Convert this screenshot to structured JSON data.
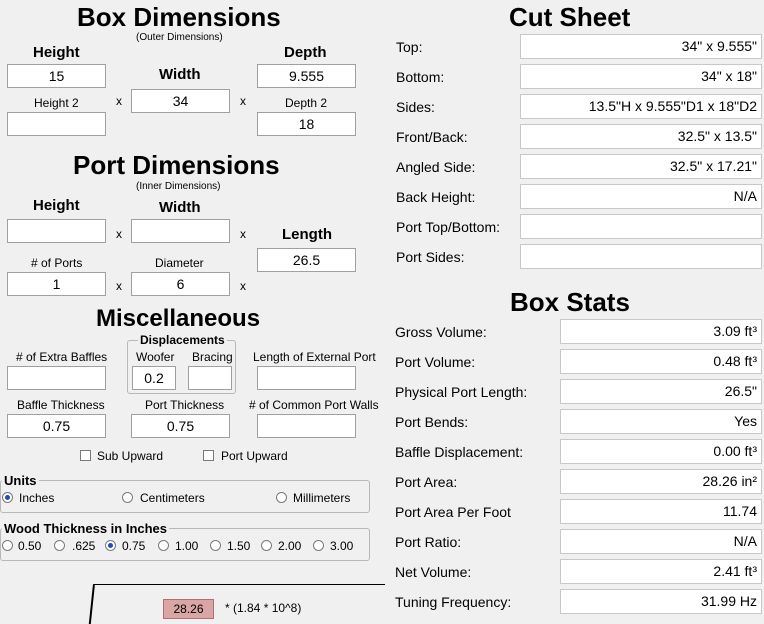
{
  "box_dimensions": {
    "title": "Box Dimensions",
    "subtitle": "(Outer Dimensions)",
    "height_label": "Height",
    "width_label": "Width",
    "depth_label": "Depth",
    "height2_label": "Height 2",
    "depth2_label": "Depth 2",
    "height": "15",
    "width": "34",
    "depth": "9.555",
    "height2": "",
    "depth2": "18",
    "times": "x"
  },
  "port_dimensions": {
    "title": "Port Dimensions",
    "subtitle": "(Inner Dimensions)",
    "height_label": "Height",
    "width_label": "Width",
    "length_label": "Length",
    "num_ports_label": "# of Ports",
    "diameter_label": "Diameter",
    "height": "",
    "width": "",
    "length": "26.5",
    "num_ports": "1",
    "diameter": "6"
  },
  "misc": {
    "title": "Miscellaneous",
    "extra_baffles_label": "# of Extra Baffles",
    "displacements_label": "Displacements",
    "woofer_label": "Woofer",
    "bracing_label": "Bracing",
    "ext_port_label": "Length of External Port",
    "baffle_thickness_label": "Baffle Thickness",
    "port_thickness_label": "Port Thickness",
    "common_walls_label": "# of Common Port Walls",
    "extra_baffles": "",
    "woofer": "0.2",
    "bracing": "",
    "ext_port": "",
    "baffle_thickness": "0.75",
    "port_thickness": "0.75",
    "common_walls": "",
    "sub_upward_label": "Sub Upward",
    "port_upward_label": "Port Upward"
  },
  "units": {
    "title": "Units",
    "options": [
      "Inches",
      "Centimeters",
      "Millimeters"
    ],
    "selected": "Inches"
  },
  "wood": {
    "title": "Wood Thickness in Inches",
    "options": [
      "0.50",
      ".625",
      "0.75",
      "1.00",
      "1.50",
      "2.00",
      "3.00"
    ],
    "selected": "0.75"
  },
  "formula": {
    "value": "28.26",
    "text": "* (1.84 * 10^8)"
  },
  "cut_sheet": {
    "title": "Cut Sheet",
    "rows": [
      {
        "label": "Top:",
        "value": "34\" x 9.555\""
      },
      {
        "label": "Bottom:",
        "value": "34\" x 18\""
      },
      {
        "label": "Sides:",
        "value": "13.5\"H x 9.555\"D1 x 18\"D2"
      },
      {
        "label": "Front/Back:",
        "value": "32.5\" x 13.5\""
      },
      {
        "label": "Angled Side:",
        "value": "32.5\" x 17.21\""
      },
      {
        "label": "Back Height:",
        "value": "N/A"
      },
      {
        "label": "Port Top/Bottom:",
        "value": ""
      },
      {
        "label": "Port Sides:",
        "value": ""
      }
    ]
  },
  "box_stats": {
    "title": "Box Stats",
    "rows": [
      {
        "label": "Gross Volume:",
        "value": "3.09 ft³"
      },
      {
        "label": "Port Volume:",
        "value": "0.48 ft³"
      },
      {
        "label": "Physical Port Length:",
        "value": "26.5\""
      },
      {
        "label": "Port Bends:",
        "value": "Yes"
      },
      {
        "label": "Baffle Displacement:",
        "value": "0.00 ft³"
      },
      {
        "label": "Port Area:",
        "value": "28.26 in²"
      },
      {
        "label": "Port Area Per Foot",
        "value": "11.74"
      },
      {
        "label": "Port Ratio:",
        "value": "N/A"
      },
      {
        "label": "Net Volume:",
        "value": "2.41 ft³"
      },
      {
        "label": "Tuning Frequency:",
        "value": "31.99 Hz"
      }
    ]
  }
}
